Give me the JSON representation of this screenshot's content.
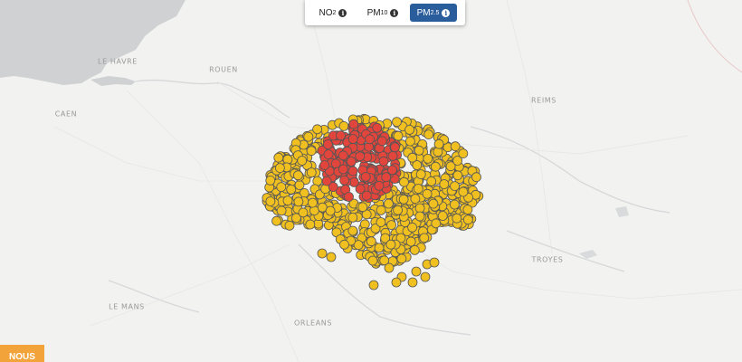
{
  "pollutant_switch": {
    "options": [
      {
        "base": "NO",
        "sub": "2",
        "icon": "info-icon",
        "selected": false
      },
      {
        "base": "PM",
        "sub": "10",
        "icon": "info-icon",
        "selected": false
      },
      {
        "base": "PM",
        "sub": "2.5",
        "icon": "info-icon",
        "selected": true
      }
    ],
    "icon_glyph": "i",
    "active_color": "#2a5d9c"
  },
  "cities": [
    "LE HAVRE",
    "ROUEN",
    "CAEN",
    "REIMS",
    "TROYES",
    "LE MANS",
    "ORLEANS"
  ],
  "markers": {
    "colors": {
      "moderate": "#f0c020",
      "high": "#e2453c",
      "outline": "#555555"
    }
  },
  "footer_button": {
    "label": "NOUS",
    "color": "#f2a33a"
  }
}
